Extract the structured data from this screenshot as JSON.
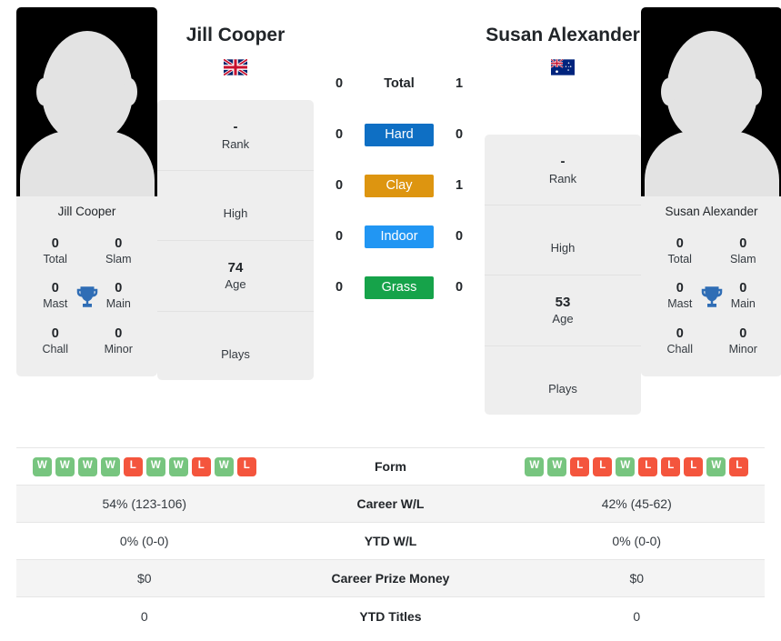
{
  "colors": {
    "hard": "#0e6fc4",
    "clay": "#dd9510",
    "indoor": "#2196f3",
    "grass": "#16a34a",
    "win": "#77c57f",
    "loss": "#f4553d",
    "trophy": "#2f6db5",
    "card_bg": "#eeeeee",
    "row_alt_bg": "#f4f4f4"
  },
  "players": {
    "left": {
      "name": "Jill Cooper",
      "photo_caption": "Jill Cooper",
      "country": "United Kingdom",
      "flag_icon": "flag-gb",
      "titles": [
        {
          "value": "0",
          "label": "Total"
        },
        {
          "value": "0",
          "label": "Slam"
        },
        {
          "value": "0",
          "label": "Mast"
        },
        {
          "value": "0",
          "label": "Main"
        },
        {
          "value": "0",
          "label": "Chall"
        },
        {
          "value": "0",
          "label": "Minor"
        }
      ],
      "info": [
        {
          "value": "-",
          "label": "Rank"
        },
        {
          "value": "",
          "label": "High"
        },
        {
          "value": "74",
          "label": "Age"
        },
        {
          "value": "",
          "label": "Plays"
        }
      ],
      "form": [
        "W",
        "W",
        "W",
        "W",
        "L",
        "W",
        "W",
        "L",
        "W",
        "L"
      ],
      "career_wl": "54% (123-106)",
      "ytd_wl": "0% (0-0)",
      "career_prize_money": "$0",
      "ytd_titles": "0"
    },
    "right": {
      "name": "Susan Alexander",
      "photo_caption": "Susan Alexander",
      "country": "Australia",
      "flag_icon": "flag-au",
      "titles": [
        {
          "value": "0",
          "label": "Total"
        },
        {
          "value": "0",
          "label": "Slam"
        },
        {
          "value": "0",
          "label": "Mast"
        },
        {
          "value": "0",
          "label": "Main"
        },
        {
          "value": "0",
          "label": "Chall"
        },
        {
          "value": "0",
          "label": "Minor"
        }
      ],
      "info": [
        {
          "value": "-",
          "label": "Rank"
        },
        {
          "value": "",
          "label": "High"
        },
        {
          "value": "53",
          "label": "Age"
        },
        {
          "value": "",
          "label": "Plays"
        }
      ],
      "form": [
        "W",
        "W",
        "L",
        "L",
        "W",
        "L",
        "L",
        "L",
        "W",
        "L"
      ],
      "career_wl": "42% (45-62)",
      "ytd_wl": "0% (0-0)",
      "career_prize_money": "$0",
      "ytd_titles": "0"
    }
  },
  "head_to_head": {
    "total": {
      "label": "Total",
      "left": "0",
      "right": "1"
    },
    "surfaces": [
      {
        "label": "Hard",
        "left": "0",
        "right": "0",
        "color_key": "hard"
      },
      {
        "label": "Clay",
        "left": "0",
        "right": "1",
        "color_key": "clay"
      },
      {
        "label": "Indoor",
        "left": "0",
        "right": "0",
        "color_key": "indoor"
      },
      {
        "label": "Grass",
        "left": "0",
        "right": "0",
        "color_key": "grass"
      }
    ]
  },
  "stats_table": {
    "rows": [
      {
        "label": "Form",
        "type": "form"
      },
      {
        "label": "Career W/L",
        "type": "text",
        "left": "54% (123-106)",
        "right": "42% (45-62)"
      },
      {
        "label": "YTD W/L",
        "type": "text",
        "left": "0% (0-0)",
        "right": "0% (0-0)"
      },
      {
        "label": "Career Prize Money",
        "type": "text",
        "left": "$0",
        "right": "$0"
      },
      {
        "label": "YTD Titles",
        "type": "text",
        "left": "0",
        "right": "0"
      }
    ]
  }
}
